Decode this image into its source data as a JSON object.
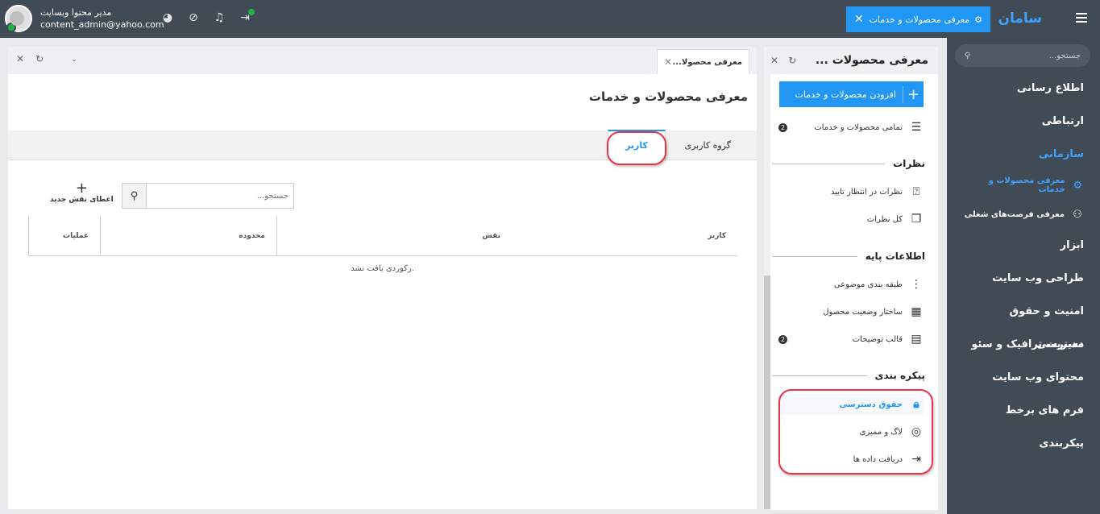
{
  "topbar": {
    "brand": "سامان",
    "active_tab": "معرفی محصولات و خدمات",
    "user_name": "مدیر محتوا وبسایت",
    "user_email": "content_admin@yahoo.com",
    "icons": [
      "palette-icon",
      "pin-off-icon",
      "bell-icon",
      "exit-icon"
    ]
  },
  "sidebar": {
    "search_placeholder": "جستجو...",
    "items": [
      {
        "label": "اطلاع رسانی"
      },
      {
        "label": "ارتباطی"
      },
      {
        "label": "سازمانی"
      },
      {
        "label": "ابزار"
      },
      {
        "label": "طراحی وب سایت"
      },
      {
        "label": "امنیت و حقوق دسترسی"
      },
      {
        "label": "مدیریت ترافیک و سئو"
      },
      {
        "label": "محتوای وب سایت"
      },
      {
        "label": "فرم های برخط"
      },
      {
        "label": "پیکربندی"
      }
    ],
    "sub_items": [
      {
        "label": "معرفی محصولات و خدمات"
      },
      {
        "label": "معرفی فرصت‌های شغلی"
      }
    ]
  },
  "midcol": {
    "title": "معرفی محصولات ...",
    "add_button": "افزودن محصولات و خدمات",
    "all_items": "تمامی محصولات و خدمات",
    "all_items_count": "2",
    "sections": {
      "comments": "نظرات",
      "base_info": "اطلاعات پایه",
      "config": "پیکره بندی"
    },
    "comments_items": [
      "نظرات در انتظار تایید",
      "کل نظرات"
    ],
    "base_items": [
      "طبقه بندی موضوعی",
      "ساختار وضعیت محصول",
      "قالب توضیحات"
    ],
    "template_count": "2",
    "config_items": [
      "حقوق دسترسی",
      "لاگ و ممیزی",
      "دریافت داده ها"
    ]
  },
  "main": {
    "doc_tab": "معرفی محصولا...",
    "page_title": "معرفی محصولات و خدمات",
    "tabs": [
      "گروه کاربری",
      "کاربر"
    ],
    "search_placeholder": "جستجو...",
    "new_role": "اعطای نقش جدید",
    "columns": [
      "کاربر",
      "نقش",
      "محدوده",
      "عملیات"
    ],
    "empty_text": "رکوردی یافت نشد."
  },
  "colors": {
    "topbar": "#414b56",
    "accent": "#2196f3",
    "highlight_ring": "#e8334a",
    "online": "#1fb141"
  }
}
